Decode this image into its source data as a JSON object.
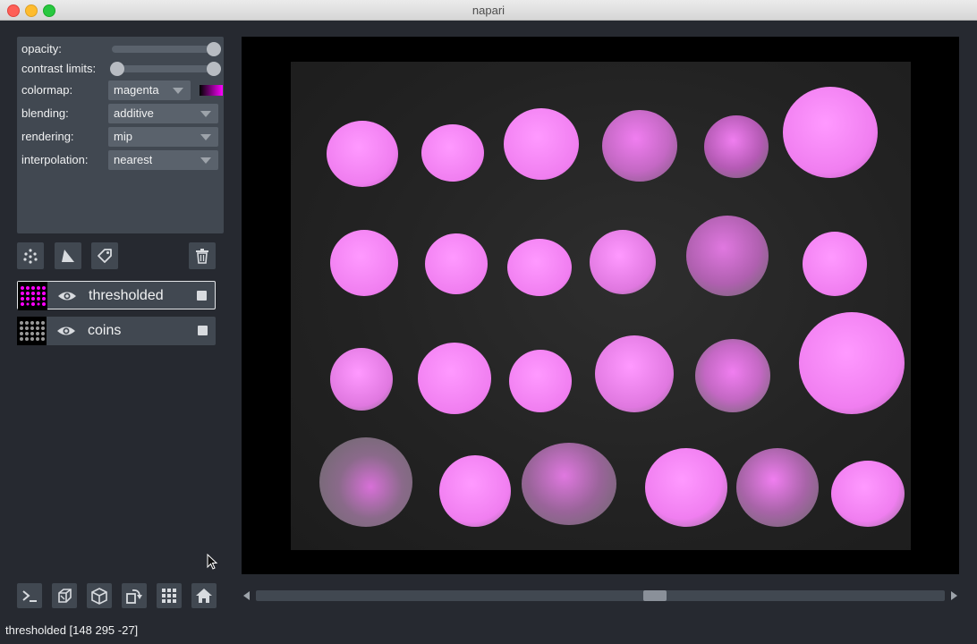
{
  "window": {
    "title": "napari"
  },
  "controls": {
    "opacity_label": "opacity:",
    "opacity_value": 1.0,
    "contrast_label": "contrast limits:",
    "contrast_range": [
      0.0,
      1.0
    ],
    "colormap_label": "colormap:",
    "colormap_value": "magenta",
    "colormap_color": "#ff00ff",
    "blending_label": "blending:",
    "blending_value": "additive",
    "rendering_label": "rendering:",
    "rendering_value": "mip",
    "interpolation_label": "interpolation:",
    "interpolation_value": "nearest"
  },
  "layer_buttons": [
    "new-points-icon",
    "new-shapes-icon",
    "new-labels-icon",
    "delete-layer-icon"
  ],
  "layers": [
    {
      "name": "thresholded",
      "selected": true,
      "visible": true
    },
    {
      "name": "coins",
      "selected": false,
      "visible": true
    }
  ],
  "bottom_buttons": [
    "console-icon",
    "ndisplay-icon",
    "roll-dims-icon",
    "transpose-icon",
    "grid-icon",
    "home-icon"
  ],
  "status": {
    "text": "thresholded [148 295 -27]"
  },
  "colors": {
    "background": "#262930",
    "panel": "#414851",
    "highlight": "#ff88ff",
    "coin_gray": "#6e6e6e"
  }
}
